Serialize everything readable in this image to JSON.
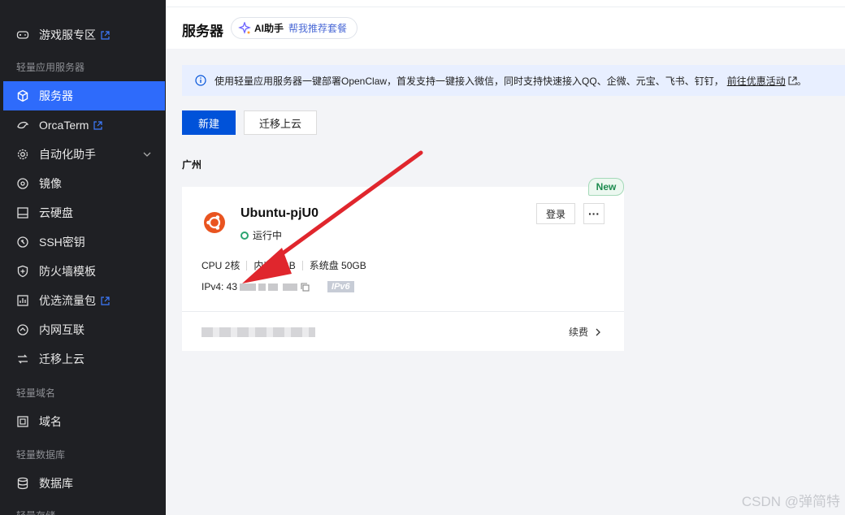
{
  "sidebar": {
    "items": [
      {
        "label": "游戏服专区",
        "icon": "gamepad-icon",
        "external": true
      },
      {
        "label": "服务器",
        "icon": "cube-icon",
        "active": true
      },
      {
        "label": "OrcaTerm",
        "icon": "orca-icon",
        "external": true
      },
      {
        "label": "自动化助手",
        "icon": "gear-icon",
        "expandable": true
      },
      {
        "label": "镜像",
        "icon": "disc-icon"
      },
      {
        "label": "云硬盘",
        "icon": "disk-icon"
      },
      {
        "label": "SSH密钥",
        "icon": "key-icon"
      },
      {
        "label": "防火墙模板",
        "icon": "shield-icon"
      },
      {
        "label": "优选流量包",
        "icon": "chart-icon",
        "external": true
      },
      {
        "label": "内网互联",
        "icon": "network-icon"
      },
      {
        "label": "迁移上云",
        "icon": "migrate-icon"
      },
      {
        "label": "域名",
        "icon": "domain-icon"
      },
      {
        "label": "数据库",
        "icon": "database-icon"
      }
    ],
    "groups": [
      "轻量应用服务器",
      "轻量域名",
      "轻量数据库",
      "轻量存储"
    ]
  },
  "header": {
    "title": "服务器",
    "ai_label": "AI助手",
    "ai_sub": "帮我推荐套餐"
  },
  "notice": {
    "text": "使用轻量应用服务器一键部署OpenClaw，首发支持一键接入微信，同时支持快速接入QQ、企微、元宝、飞书、钉钉，",
    "link": "前往优惠活动",
    "suffix": "。"
  },
  "toolbar": {
    "new_label": "新建",
    "migrate_label": "迁移上云"
  },
  "region": "广州",
  "card": {
    "badge": "New",
    "name": "Ubuntu-pjU0",
    "status": "运行中",
    "cpu": "CPU 2核",
    "memory": "内存 2GB",
    "disk": "系统盘 50GB",
    "ipv4_label": "IPv4: 43",
    "ipv6": "IPv6",
    "login": "登录",
    "more": "···",
    "renew": "续费"
  },
  "colors": {
    "sidebar_bg": "#1f2024",
    "active": "#2e6bfb",
    "primary": "#0052d9",
    "running": "#2ba471",
    "arrow": "#e0262d"
  },
  "watermark": "CSDN @弹简特"
}
